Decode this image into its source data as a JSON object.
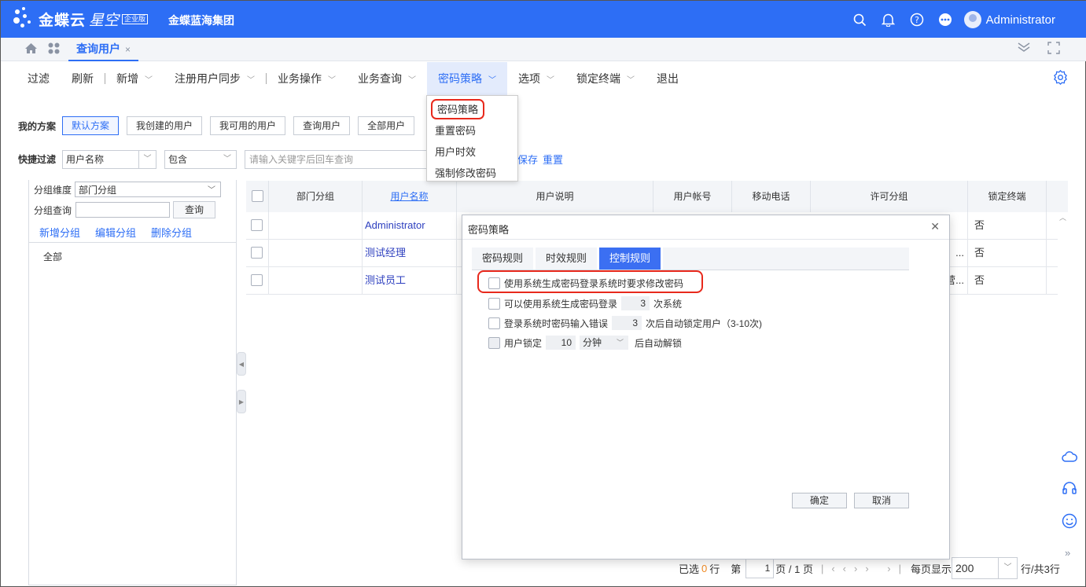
{
  "header": {
    "brand": "金蝶云",
    "brand_sub": "星空",
    "edition": "企业版",
    "company": "金蝶蓝海集团",
    "user": "Administrator",
    "icons": [
      "search-icon",
      "bell-icon",
      "help-icon",
      "more-icon"
    ]
  },
  "tabs": {
    "active": "查询用户",
    "close": "×"
  },
  "toolbar": {
    "items": [
      "过滤",
      "刷新",
      "新增",
      "注册用户同步",
      "业务操作",
      "业务查询",
      "密码策略",
      "选项",
      "锁定终端",
      "退出"
    ]
  },
  "dropdown": {
    "items": [
      "密码策略",
      "重置密码",
      "用户时效",
      "强制修改密码"
    ]
  },
  "scheme": {
    "label": "我的方案",
    "buttons": [
      "默认方案",
      "我创建的用户",
      "我可用的用户",
      "查询用户",
      "全部用户"
    ]
  },
  "quick_filter": {
    "label": "快捷过滤",
    "field": "用户名称",
    "operator": "包含",
    "placeholder": "请输入关键字后回车查询",
    "save": "保存",
    "reset": "重置"
  },
  "left_panel": {
    "group_dim_label": "分组维度",
    "group_dim_value": "部门分组",
    "group_query_label": "分组查询",
    "query_btn": "查询",
    "actions": [
      "新增分组",
      "编辑分组",
      "删除分组"
    ],
    "tree_root": "全部"
  },
  "grid": {
    "columns": [
      "部门分组",
      "用户名称",
      "用户说明",
      "用户帐号",
      "移动电话",
      "许可分组",
      "锁定终端"
    ],
    "rows": [
      {
        "name": "Administrator",
        "license_tail": "",
        "locked": "否"
      },
      {
        "name": "测试经理",
        "license_tail": "...",
        "locked": "否"
      },
      {
        "name": "测试员工",
        "license_tail": "营...",
        "locked": "否"
      }
    ]
  },
  "pager": {
    "selected_prefix": "已选",
    "selected_count": "0",
    "selected_suffix": "行",
    "page_prefix": "第",
    "page": "1",
    "page_total": "页 / 1 页",
    "per_page_label": "每页显示",
    "per_page": "200",
    "total": "行/共3行"
  },
  "dialog": {
    "title": "密码策略",
    "tabs": [
      "密码规则",
      "时效规则",
      "控制规则"
    ],
    "options": {
      "opt1": "使用系统生成密码登录系统时要求修改密码",
      "opt2_pre": "可以使用系统生成密码登录",
      "opt2_num": "3",
      "opt2_post": "次系统",
      "opt3_pre": "登录系统时密码输入错误",
      "opt3_num": "3",
      "opt3_post": "次后自动锁定用户（3-10次)",
      "opt4_pre": "用户锁定",
      "opt4_num": "10",
      "opt4_unit": "分钟",
      "opt4_post": "后自动解锁"
    },
    "ok": "确定",
    "cancel": "取消"
  }
}
